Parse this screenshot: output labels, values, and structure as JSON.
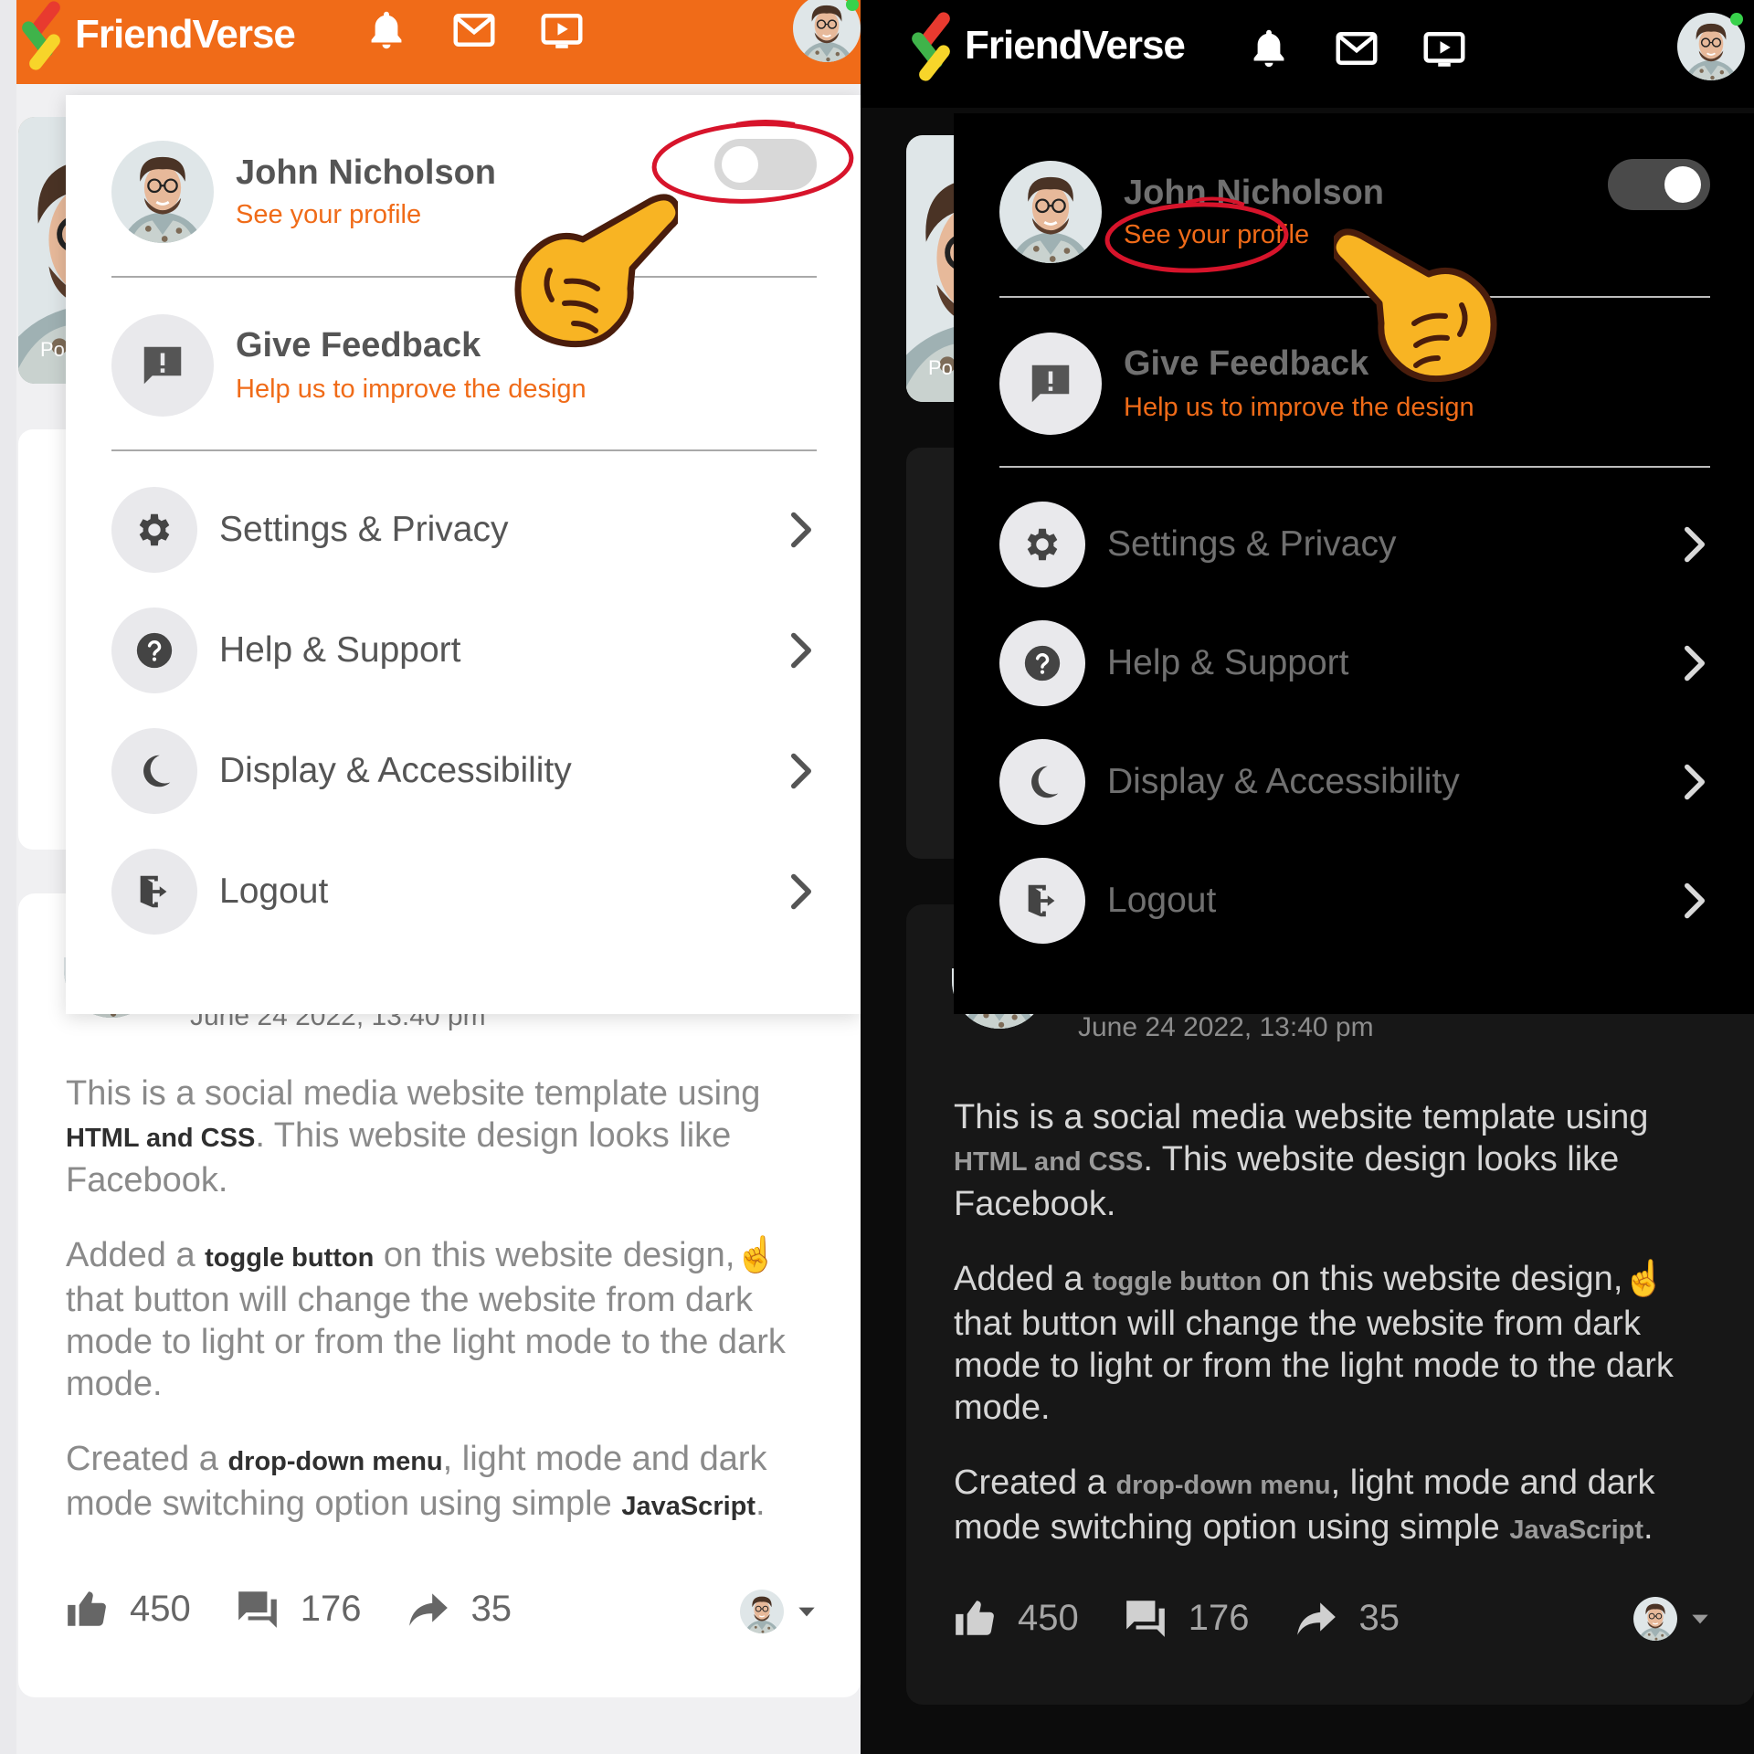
{
  "brand": {
    "name": "FriendVerse"
  },
  "colors": {
    "accent": "#f06b18",
    "light_bg": "#ffffff",
    "dark_bg": "#000000",
    "online": "#38d14b"
  },
  "nav_icons": [
    "bell-icon",
    "mail-icon",
    "video-icon"
  ],
  "story": {
    "label": "Po"
  },
  "profile": {
    "name": "John Nicholson",
    "link": "See your profile"
  },
  "toggle": {
    "light_mode_state": "off",
    "dark_mode_state": "on"
  },
  "feedback": {
    "title": "Give Feedback",
    "subtitle": "Help us to improve the design"
  },
  "menu_items": [
    {
      "label": "Settings & Privacy",
      "icon": "gear-icon"
    },
    {
      "label": "Help & Support",
      "icon": "question-icon"
    },
    {
      "label": "Display & Accessibility",
      "icon": "moon-icon"
    },
    {
      "label": "Logout",
      "icon": "logout-icon"
    }
  ],
  "post": {
    "date": "June 24 2022, 13:40 pm",
    "p1_a": "This is a social media website template using ",
    "p1_b": "HTML and CSS",
    "p1_c": ". This website design looks like Facebook.",
    "p2_a": "Added a ",
    "p2_b": "toggle button",
    "p2_c": " on this website design,",
    "p2_d": " that button will change the website from dark mode to light or from the light mode to the dark mode.",
    "p3_a": "Created a ",
    "p3_b": "drop-down menu",
    "p3_c": ", light mode and dark mode switching option using simple ",
    "p3_d": "JavaScript",
    "p3_e": ".",
    "likes": "450",
    "comments": "176",
    "shares": "35"
  }
}
